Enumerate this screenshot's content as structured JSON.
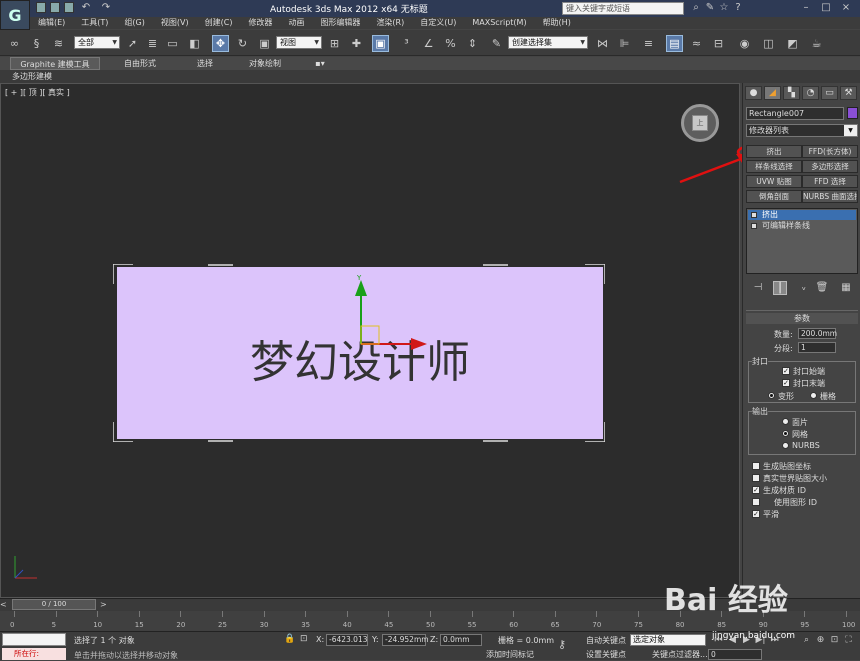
{
  "app": {
    "title": "Autodesk 3ds Max  2012 x64     无标题",
    "search_placeholder": "键入关键字或短语",
    "logo_letter": "G"
  },
  "menu": [
    "编辑(E)",
    "工具(T)",
    "组(G)",
    "视图(V)",
    "创建(C)",
    "修改器",
    "动画",
    "图形编辑器",
    "渲染(R)",
    "自定义(U)",
    "MAXScript(M)",
    "帮助(H)"
  ],
  "toolbar": {
    "filter_dropdown": "全部",
    "coord_dropdown": "视图",
    "named_selection": "创建选择集"
  },
  "ribbon": {
    "tabs": [
      "Graphite 建模工具",
      "自由形式",
      "选择",
      "对象绘制"
    ],
    "sub_label": "多边形建模"
  },
  "viewport": {
    "label": "[ + ][ 顶 ][ 真实 ]",
    "shape_text": "梦幻设计师",
    "viewcube_face": "上",
    "shape_color": "#dcc4fb"
  },
  "command_panel": {
    "object_name": "Rectangle007",
    "object_color": "#8a4fd6",
    "modifier_list": "修改器列表",
    "modifier_buttons": [
      "挤出",
      "FFD(长方体)",
      "样条线选择",
      "多边形选择",
      "UVW 贴图",
      "FFD 选择",
      "倒角剖面",
      "NURBS 曲面选择"
    ],
    "stack": [
      "挤出",
      "可编辑样条线"
    ],
    "params_title": "参数",
    "amount_label": "数量:",
    "amount_value": "200.0mm",
    "segments_label": "分段:",
    "segments_value": "1",
    "capping_title": "封口",
    "cap_start": "封口始端",
    "cap_end": "封口末端",
    "morph": "变形",
    "grid": "栅格",
    "output_title": "输出",
    "out_patch": "面片",
    "out_mesh": "网格",
    "out_nurbs": "NURBS",
    "gen_map": "生成贴图坐标",
    "real_world": "真实世界贴图大小",
    "gen_mat": "生成材质 ID",
    "use_shape": "使用图形 ID",
    "smooth": "平滑"
  },
  "timeline": {
    "frame_label": "0 / 100",
    "ticks": [
      "0",
      "5",
      "10",
      "15",
      "20",
      "25",
      "30",
      "35",
      "40",
      "45",
      "50",
      "55",
      "60",
      "65",
      "70",
      "75",
      "80",
      "85",
      "90",
      "95",
      "100"
    ]
  },
  "status": {
    "listener": "所在行:",
    "selected": "选择了 1 个 对象",
    "prompt": "单击并拖动以选择并移动对象",
    "x_label": "X:",
    "x_value": "-6423.013",
    "y_label": "Y:",
    "y_value": "-24.952mm",
    "z_label": "Z:",
    "z_value": "0.0mm",
    "grid": "栅格 = 0.0mm",
    "add_time": "添加时间标记",
    "autokey": "自动关键点",
    "selset": "选定对象",
    "setkey": "设置关键点",
    "keyfilter": "关键点过滤器...",
    "frame_value": "0"
  },
  "watermark": {
    "brand": "Bai 经验",
    "url": "jingyan.baidu.com"
  }
}
